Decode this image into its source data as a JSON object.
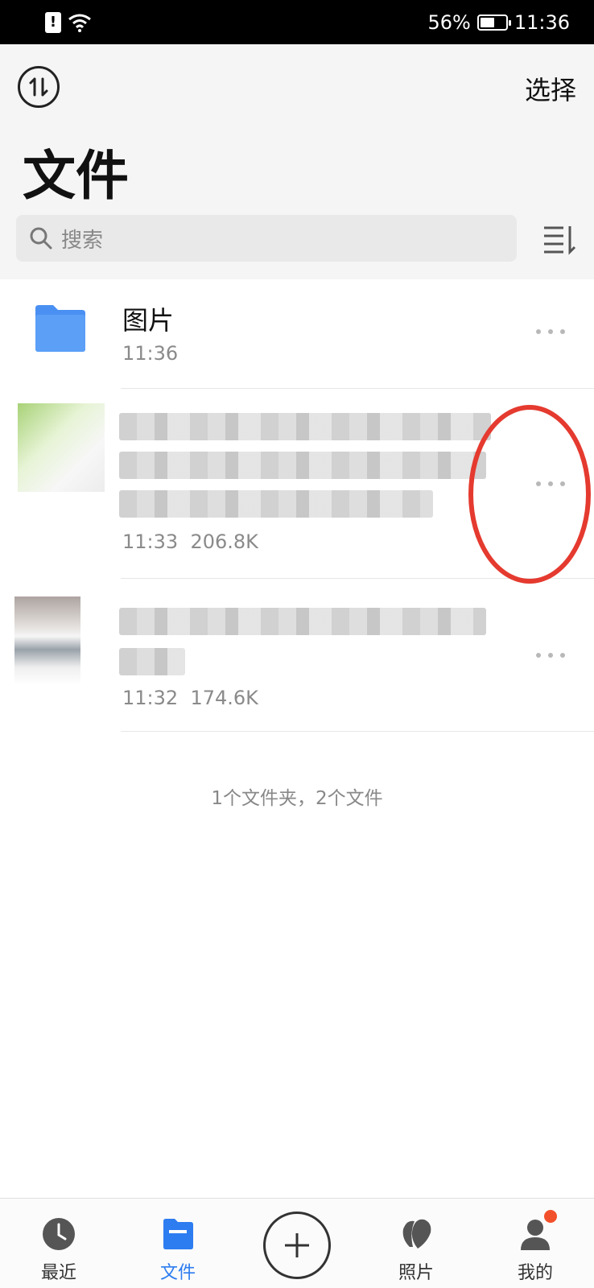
{
  "status_bar": {
    "battery": "56%",
    "time": "11:36",
    "battery_level": 0.56
  },
  "header": {
    "select_label": "选择",
    "title": "文件"
  },
  "search": {
    "placeholder": "搜索"
  },
  "files": [
    {
      "name": "图片",
      "time": "11:36",
      "size": "",
      "type": "folder"
    },
    {
      "name": "",
      "time": "11:33",
      "size": "206.8K",
      "type": "image"
    },
    {
      "name": "",
      "time": "11:32",
      "size": "174.6K",
      "type": "image"
    }
  ],
  "summary": "1个文件夹，2个文件",
  "bottom_nav": {
    "recent": "最近",
    "files": "文件",
    "photos": "照片",
    "mine": "我的"
  },
  "colors": {
    "accent": "#2d7cf0",
    "folder": "#4a90f2",
    "annotation": "#e53a2f",
    "badge": "#f2502a"
  },
  "icons": [
    "transfer-icon",
    "search-icon",
    "sort-icon",
    "folder-icon",
    "more-icon",
    "clock-icon",
    "file-icon",
    "add-icon",
    "photos-icon",
    "user-icon"
  ]
}
